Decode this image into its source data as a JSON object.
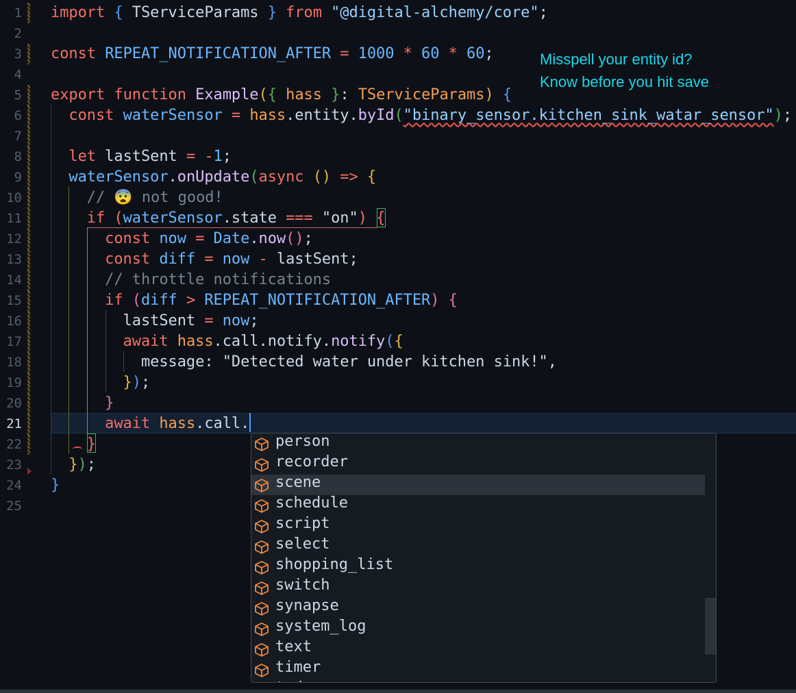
{
  "editor": {
    "active_line": 21,
    "lines": [
      [
        {
          "t": "import",
          "c": "k"
        },
        {
          "t": " ",
          "c": "p"
        },
        {
          "t": "{",
          "c": "bl"
        },
        {
          "t": " TServiceParams ",
          "c": "w"
        },
        {
          "t": "}",
          "c": "bl"
        },
        {
          "t": " ",
          "c": "p"
        },
        {
          "t": "from",
          "c": "k"
        },
        {
          "t": " \"@digital-alchemy/core\"",
          "c": "s"
        },
        {
          "t": ";",
          "c": "w"
        }
      ],
      [],
      [
        {
          "t": "const",
          "c": "k"
        },
        {
          "t": " ",
          "c": "p"
        },
        {
          "t": "REPEAT_NOTIFICATION_AFTER",
          "c": "v"
        },
        {
          "t": " = ",
          "c": "k"
        },
        {
          "t": "1000",
          "c": "n"
        },
        {
          "t": " * ",
          "c": "k"
        },
        {
          "t": "60",
          "c": "n"
        },
        {
          "t": " * ",
          "c": "k"
        },
        {
          "t": "60",
          "c": "n"
        },
        {
          "t": ";",
          "c": "w"
        }
      ],
      [],
      [
        {
          "t": "export",
          "c": "k"
        },
        {
          "t": " ",
          "c": "p"
        },
        {
          "t": "function",
          "c": "k"
        },
        {
          "t": " ",
          "c": "p"
        },
        {
          "t": "Example",
          "c": "f"
        },
        {
          "t": "(",
          "c": "y"
        },
        {
          "t": "{",
          "c": "g"
        },
        {
          "t": " ",
          "c": "p"
        },
        {
          "t": "hass",
          "c": "o"
        },
        {
          "t": " ",
          "c": "p"
        },
        {
          "t": "}",
          "c": "g"
        },
        {
          "t": ": ",
          "c": "w"
        },
        {
          "t": "TServiceParams",
          "c": "o"
        },
        {
          "t": ")",
          "c": "y"
        },
        {
          "t": " ",
          "c": "p"
        },
        {
          "t": "{",
          "c": "bl"
        }
      ],
      [
        {
          "t": "  const",
          "c": "k"
        },
        {
          "t": " ",
          "c": "p"
        },
        {
          "t": "waterSensor",
          "c": "v"
        },
        {
          "t": " = ",
          "c": "k"
        },
        {
          "t": "hass",
          "c": "o"
        },
        {
          "t": ".entity.",
          "c": "w"
        },
        {
          "t": "byId",
          "c": "f"
        },
        {
          "t": "(",
          "c": "g"
        },
        {
          "t": "\"binary_sensor.kitchen_sink_watar_sensor\"",
          "c": "s sq"
        },
        {
          "t": ")",
          "c": "g"
        },
        {
          "t": ";",
          "c": "w"
        }
      ],
      [],
      [
        {
          "t": "  let",
          "c": "k"
        },
        {
          "t": " lastSent ",
          "c": "w"
        },
        {
          "t": "= -",
          "c": "k"
        },
        {
          "t": "1",
          "c": "n"
        },
        {
          "t": ";",
          "c": "w"
        }
      ],
      [
        {
          "t": "  waterSensor",
          "c": "v"
        },
        {
          "t": ".",
          "c": "w"
        },
        {
          "t": "onUpdate",
          "c": "f"
        },
        {
          "t": "(",
          "c": "g"
        },
        {
          "t": "async",
          "c": "k"
        },
        {
          "t": " ",
          "c": "p"
        },
        {
          "t": "()",
          "c": "y"
        },
        {
          "t": " => ",
          "c": "k"
        },
        {
          "t": "{",
          "c": "y"
        }
      ],
      [
        {
          "t": "    // 😨 not good!",
          "c": "c"
        }
      ],
      [
        {
          "t": "    if",
          "c": "k"
        },
        {
          "t": " ",
          "c": "p"
        },
        {
          "t": "(",
          "c": "k"
        },
        {
          "t": "waterSensor",
          "c": "v"
        },
        {
          "t": ".state ",
          "c": "w"
        },
        {
          "t": "===",
          "c": "k"
        },
        {
          "t": " \"on\"",
          "c": "w"
        },
        {
          "t": ")",
          "c": "k"
        },
        {
          "t": " ",
          "c": "p"
        },
        {
          "t": "{",
          "c": "k"
        }
      ],
      [
        {
          "t": "      const",
          "c": "k"
        },
        {
          "t": " ",
          "c": "p"
        },
        {
          "t": "now",
          "c": "v"
        },
        {
          "t": " = ",
          "c": "k"
        },
        {
          "t": "Date",
          "c": "v"
        },
        {
          "t": ".",
          "c": "w"
        },
        {
          "t": "now",
          "c": "f"
        },
        {
          "t": "()",
          "c": "pk"
        },
        {
          "t": ";",
          "c": "w"
        }
      ],
      [
        {
          "t": "      const",
          "c": "k"
        },
        {
          "t": " ",
          "c": "p"
        },
        {
          "t": "diff",
          "c": "v"
        },
        {
          "t": " = ",
          "c": "k"
        },
        {
          "t": "now",
          "c": "v"
        },
        {
          "t": " - ",
          "c": "k"
        },
        {
          "t": "lastSent",
          "c": "w"
        },
        {
          "t": ";",
          "c": "w"
        }
      ],
      [
        {
          "t": "      // throttle notifications",
          "c": "c"
        }
      ],
      [
        {
          "t": "      if",
          "c": "k"
        },
        {
          "t": " ",
          "c": "p"
        },
        {
          "t": "(",
          "c": "pk"
        },
        {
          "t": "diff",
          "c": "v"
        },
        {
          "t": " > ",
          "c": "k"
        },
        {
          "t": "REPEAT_NOTIFICATION_AFTER",
          "c": "v"
        },
        {
          "t": ")",
          "c": "pk"
        },
        {
          "t": " ",
          "c": "p"
        },
        {
          "t": "{",
          "c": "pk"
        }
      ],
      [
        {
          "t": "        lastSent",
          "c": "w"
        },
        {
          "t": " = ",
          "c": "k"
        },
        {
          "t": "now",
          "c": "v"
        },
        {
          "t": ";",
          "c": "w"
        }
      ],
      [
        {
          "t": "        await",
          "c": "k"
        },
        {
          "t": " ",
          "c": "p"
        },
        {
          "t": "hass",
          "c": "o"
        },
        {
          "t": ".call.notify.",
          "c": "w"
        },
        {
          "t": "notify",
          "c": "f"
        },
        {
          "t": "(",
          "c": "bl"
        },
        {
          "t": "{",
          "c": "y"
        }
      ],
      [
        {
          "t": "          message: ",
          "c": "w"
        },
        {
          "t": "\"Detected water under kitchen sink!\"",
          "c": "w"
        },
        {
          "t": ",",
          "c": "w"
        }
      ],
      [
        {
          "t": "        }",
          "c": "y"
        },
        {
          "t": ")",
          "c": "bl"
        },
        {
          "t": ";",
          "c": "w"
        }
      ],
      [
        {
          "t": "      }",
          "c": "pk"
        }
      ],
      [
        {
          "t": "      await",
          "c": "k"
        },
        {
          "t": " ",
          "c": "p"
        },
        {
          "t": "hass",
          "c": "o"
        },
        {
          "t": ".call.",
          "c": "w"
        }
      ],
      [
        {
          "t": "    }",
          "c": "k"
        }
      ],
      [
        {
          "t": "  }",
          "c": "y"
        },
        {
          "t": ")",
          "c": "g"
        },
        {
          "t": ";",
          "c": "w"
        }
      ],
      [
        {
          "t": "}",
          "c": "bl"
        }
      ],
      []
    ]
  },
  "annotation": {
    "line1": "Misspell your entity id?",
    "line2": "Know before you hit save"
  },
  "suggest": {
    "icon": "module-cube-icon",
    "icon_color": "#f0883e",
    "selected_index": 2,
    "items": [
      "person",
      "recorder",
      "scene",
      "schedule",
      "script",
      "select",
      "shopping_list",
      "switch",
      "synapse",
      "system_log",
      "text",
      "timer",
      "todo"
    ]
  }
}
